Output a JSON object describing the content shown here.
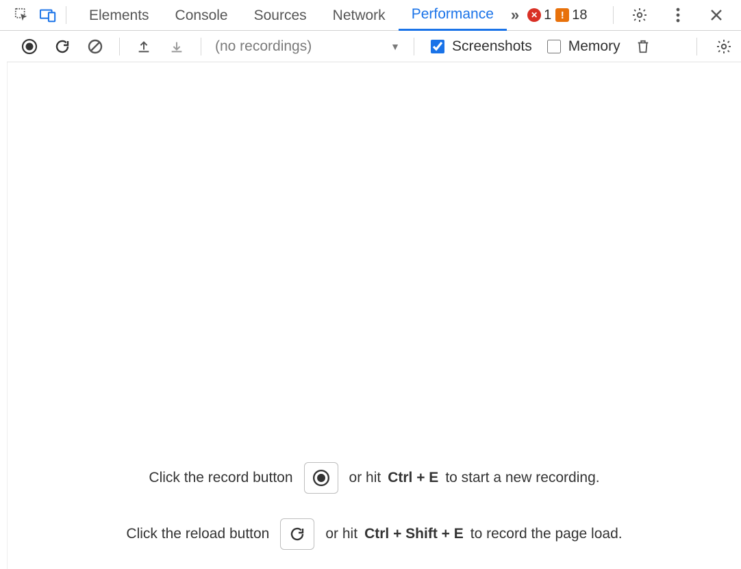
{
  "tabs": {
    "items": [
      "Elements",
      "Console",
      "Sources",
      "Network",
      "Performance"
    ],
    "active_index": 4,
    "more": "»"
  },
  "status": {
    "errors": "1",
    "warnings": "18"
  },
  "toolbar": {
    "recordings_placeholder": "(no recordings)",
    "screenshots_label": "Screenshots",
    "screenshots_checked": true,
    "memory_label": "Memory",
    "memory_checked": false
  },
  "hints": {
    "line1_a": "Click the record button",
    "line1_b": "or hit",
    "line1_shortcut": "Ctrl + E",
    "line1_c": "to start a new recording.",
    "line2_a": "Click the reload button",
    "line2_b": "or hit",
    "line2_shortcut": "Ctrl + Shift + E",
    "line2_c": "to record the page load."
  }
}
